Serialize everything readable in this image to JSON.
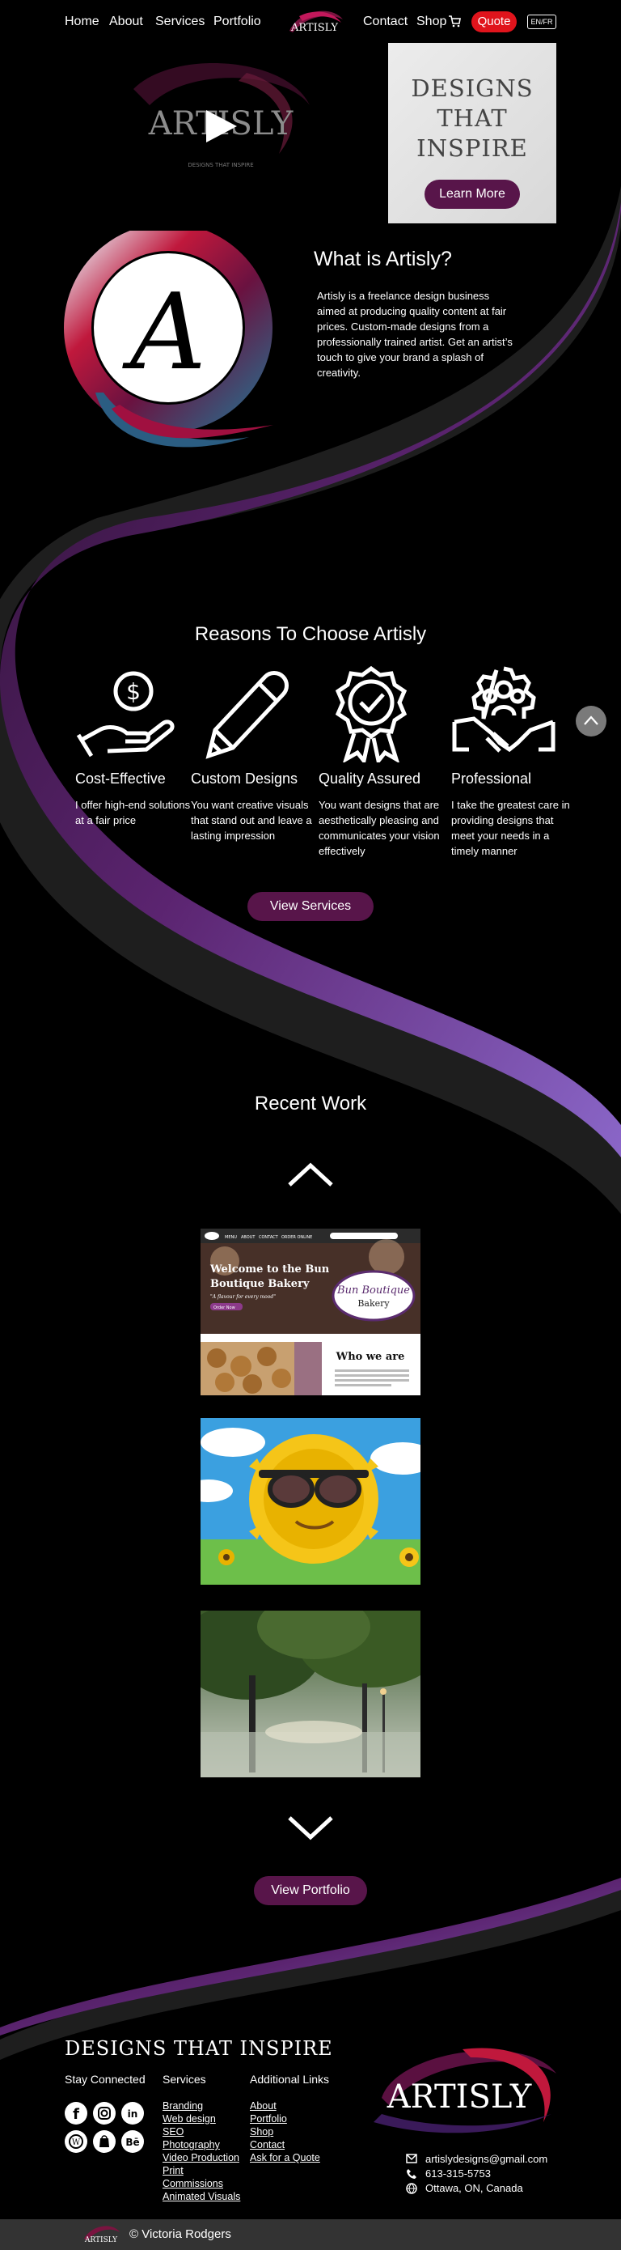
{
  "nav": {
    "links": [
      "Home",
      "About",
      "Services",
      "Portfolio",
      "Contact",
      "Shop"
    ],
    "logo_text": "ARTISLY",
    "quote_label": "Quote",
    "lang_label": "EN/FR"
  },
  "hero": {
    "video_logo_text": "ARTISLY",
    "video_tagline": "DESIGNS THAT INSPIRE",
    "card_title_lines": [
      "DESIGNS",
      "THAT",
      "INSPIRE"
    ],
    "card_button": "Learn More"
  },
  "about": {
    "title": "What is Artisly?",
    "text": "Artisly is a freelance design business aimed at producing quality content at fair prices. Custom-made designs from a professionally trained artist. Get an artist’s touch to give your brand a splash of creativity."
  },
  "reasons": {
    "title": "Reasons To Choose Artisly",
    "items": [
      {
        "icon": "money-hand-icon",
        "title": "Cost-Effective",
        "text": "I offer high-end solutions at a fair price"
      },
      {
        "icon": "pencil-icon",
        "title": "Custom Designs",
        "text": "You want creative visuals that stand out and leave a lasting impression"
      },
      {
        "icon": "award-badge-icon",
        "title": "Quality Assured",
        "text": "You want designs that are aesthetically pleasing and communicates your vision effectively"
      },
      {
        "icon": "handshake-team-icon",
        "title": "Professional",
        "text": " I take the greatest care in providing designs that meet your needs in a timely manner"
      }
    ],
    "button": "View Services"
  },
  "recent_work": {
    "title": "Recent Work",
    "bakery": {
      "heading_lines": [
        "Welcome to the Bun",
        "Boutique Bakery"
      ],
      "tagline": "\"A flavour for every mood\"",
      "cta": "Order Now",
      "logo_lines": [
        "Bun Boutique",
        "Bakery"
      ],
      "who": "Who we are",
      "nav": [
        "MENU",
        "ABOUT",
        "CONTACT",
        "ORDER ONLINE"
      ]
    },
    "button": "View Portfolio"
  },
  "footer": {
    "tagline": "DESIGNS THAT INSPIRE",
    "stay_connected": "Stay Connected",
    "services_heading": "Services",
    "services": [
      "Branding",
      "Web design",
      "SEO",
      "Photography",
      "Video Production",
      "Print",
      "Commissions",
      "Animated Visuals"
    ],
    "additional_heading": "Additional Links",
    "additional": [
      "About",
      "Portfolio",
      "Shop",
      "Contact",
      "Ask for a Quote"
    ],
    "logo_text": "ARTISLY",
    "email": "artislydesigns@gmail.com",
    "phone": "613-315-5753",
    "location": "Ottawa, ON, Canada",
    "copyright": "© Victoria Rodgers",
    "mini_logo": "ARTISLY"
  },
  "colors": {
    "accent_purple": "#58154a",
    "quote_red": "#e0141c",
    "swoosh_purple": "#5e2a7e"
  }
}
